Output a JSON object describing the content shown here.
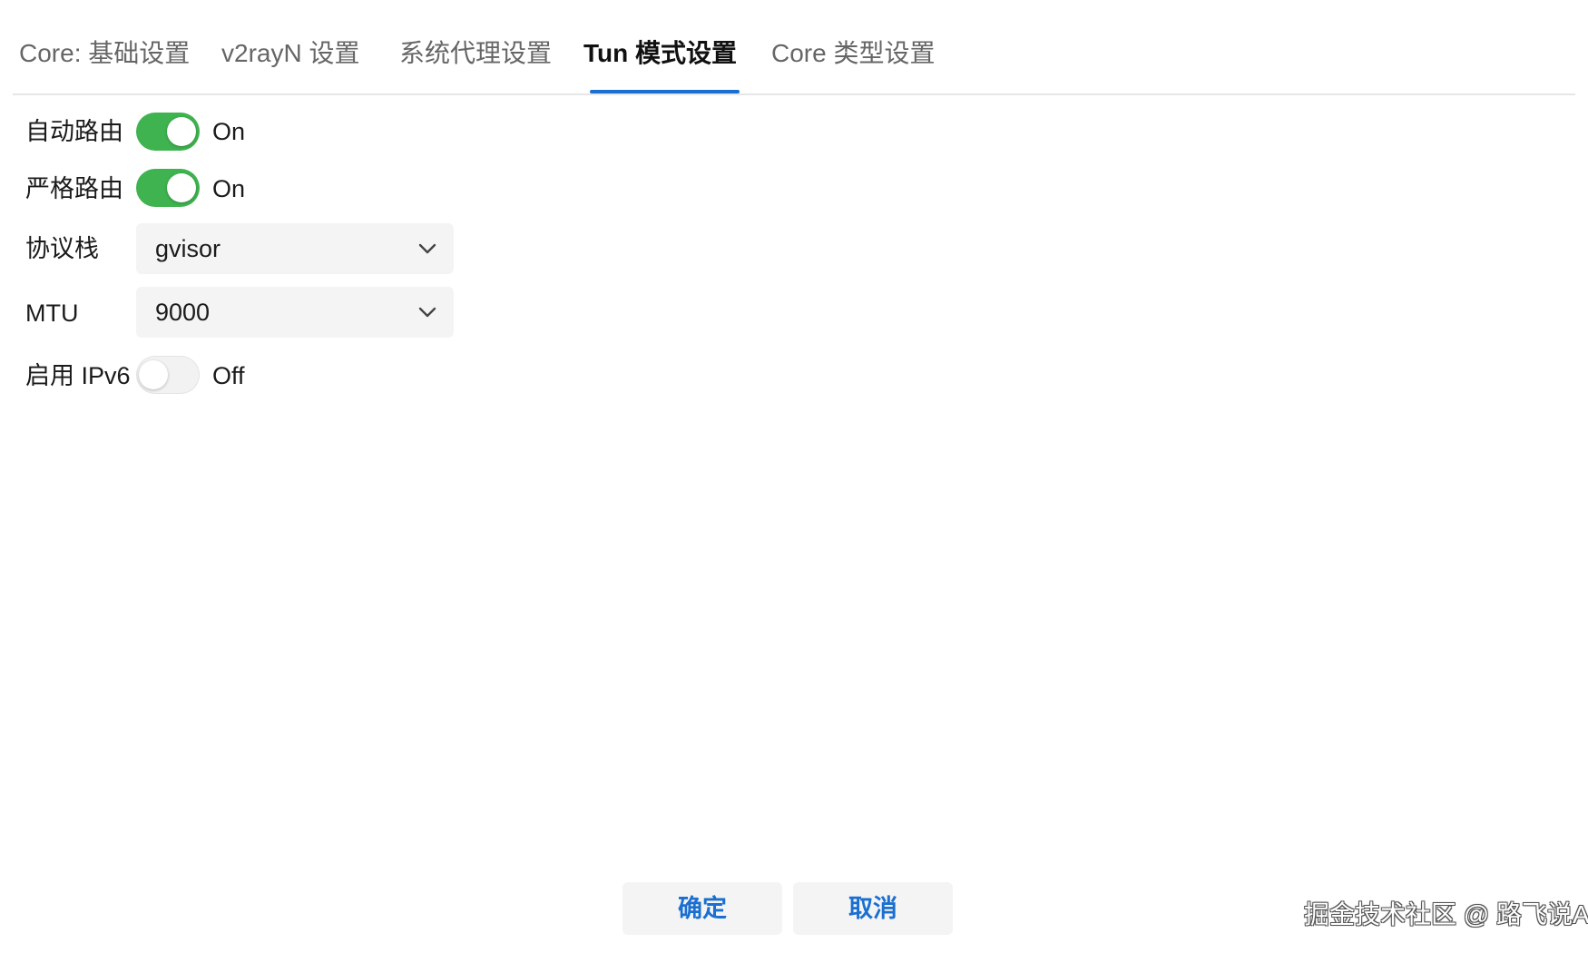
{
  "tabs": [
    {
      "label": "Core: 基础设置",
      "active": false
    },
    {
      "label": "v2rayN 设置",
      "active": false
    },
    {
      "label": "系统代理设置",
      "active": false
    },
    {
      "label": "Tun 模式设置",
      "active": true
    },
    {
      "label": "Core 类型设置",
      "active": false
    }
  ],
  "form": {
    "auto_route": {
      "label": "自动路由",
      "state": "On",
      "enabled": true
    },
    "strict_route": {
      "label": "严格路由",
      "state": "On",
      "enabled": true
    },
    "stack": {
      "label": "协议栈",
      "value": "gvisor"
    },
    "mtu": {
      "label": "MTU",
      "value": "9000"
    },
    "ipv6": {
      "label": "启用 IPv6",
      "state": "Off",
      "enabled": false
    }
  },
  "footer": {
    "ok_label": "确定",
    "cancel_label": "取消"
  },
  "watermark": "掘金技术社区 @ 路飞说AI",
  "colors": {
    "accent": "#1a6fd1",
    "toggle_on": "#3fb34f",
    "field_bg": "#f4f4f4"
  }
}
